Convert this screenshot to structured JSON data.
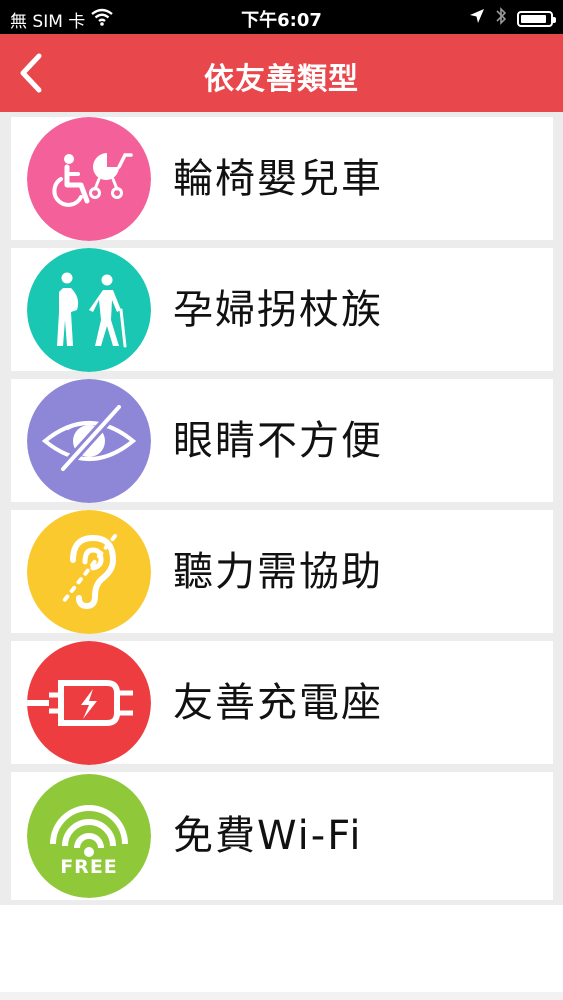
{
  "status_bar": {
    "carrier": "無 SIM 卡",
    "time": "下午6:07",
    "battery_level": 0.92
  },
  "nav": {
    "title": "依友善類型"
  },
  "colors": {
    "nav_red": "#e8474b",
    "pink": "#f4619a",
    "teal": "#19c7b3",
    "purple": "#8e87d8",
    "yellow": "#fac92e",
    "red": "#ee3d41",
    "green": "#8fc93a"
  },
  "categories": [
    {
      "label": "輪椅嬰兒車",
      "icon": "wheelchair-stroller-icon"
    },
    {
      "label": "孕婦拐杖族",
      "icon": "pregnant-elderly-icon"
    },
    {
      "label": "眼睛不方便",
      "icon": "visual-impairment-icon"
    },
    {
      "label": "聽力需協助",
      "icon": "hearing-assistance-icon"
    },
    {
      "label": "友善充電座",
      "icon": "charging-plug-icon"
    },
    {
      "label": "免費Wi-Fi",
      "icon": "free-wifi-icon",
      "badge": "FREE"
    }
  ]
}
